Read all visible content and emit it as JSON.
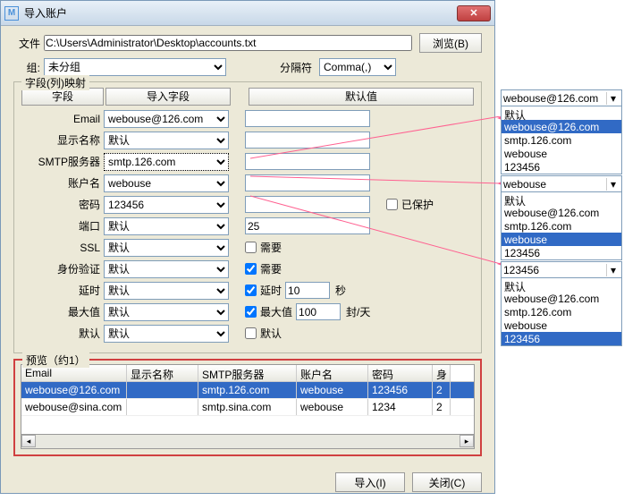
{
  "title": "导入账户",
  "fileLabel": "文件",
  "filePath": "C:\\Users\\Administrator\\Desktop\\accounts.txt",
  "browseBtn": "浏览(B)",
  "groupLabel": "组:",
  "groupValue": "未分组",
  "delimLabel": "分隔符",
  "delimValue": "Comma(,)",
  "fieldsetLegend": "字段(列)映射",
  "hdr": {
    "field": "字段",
    "import": "导入字段",
    "default": "默认值"
  },
  "rows": {
    "email": {
      "label": "Email",
      "val": "webouse@126.com",
      "def": ""
    },
    "disp": {
      "label": "显示名称",
      "val": "默认",
      "def": ""
    },
    "smtp": {
      "label": "SMTP服务器",
      "val": "smtp.126.com",
      "def": ""
    },
    "user": {
      "label": "账户名",
      "val": "webouse",
      "def": ""
    },
    "pwd": {
      "label": "密码",
      "val": "123456",
      "def": "",
      "chk": "已保护"
    },
    "port": {
      "label": "端口",
      "val": "默认",
      "def": "25"
    },
    "ssl": {
      "label": "SSL",
      "val": "默认",
      "chk": "需要"
    },
    "auth": {
      "label": "身份验证",
      "val": "默认",
      "chk": "需要"
    },
    "delay": {
      "label": "延时",
      "val": "默认",
      "chk": "延时",
      "num": "10",
      "unit": "秒"
    },
    "max": {
      "label": "最大值",
      "val": "默认",
      "chk": "最大值",
      "num": "100",
      "unit": "封/天"
    },
    "def": {
      "label": "默认",
      "val": "默认",
      "chk": "默认"
    }
  },
  "previewLegend": "预览（约1）",
  "previewCols": {
    "email": "Email",
    "disp": "显示名称",
    "smtp": "SMTP服务器",
    "user": "账户名",
    "pwd": "密码",
    "extra": "身"
  },
  "previewRows": [
    {
      "email": "webouse@126.com",
      "disp": "",
      "smtp": "smtp.126.com",
      "user": "webouse",
      "pwd": "123456",
      "extra": "2"
    },
    {
      "email": "webouse@sina.com",
      "disp": "",
      "smtp": "smtp.sina.com",
      "user": "webouse",
      "pwd": "1234",
      "extra": "2"
    }
  ],
  "importBtn": "导入(I)",
  "closeBtn": "关闭(C)",
  "dd1": {
    "sel": "webouse@126.com",
    "opts": [
      "默认",
      "webouse@126.com",
      "smtp.126.com",
      "webouse",
      "123456"
    ],
    "hi": 1
  },
  "dd2": {
    "sel": "webouse",
    "opts": [
      "默认",
      "webouse@126.com",
      "smtp.126.com",
      "webouse",
      "123456"
    ],
    "hi": 3
  },
  "dd3": {
    "sel": "123456",
    "opts": [
      "默认",
      "webouse@126.com",
      "smtp.126.com",
      "webouse",
      "123456"
    ],
    "hi": 4
  }
}
